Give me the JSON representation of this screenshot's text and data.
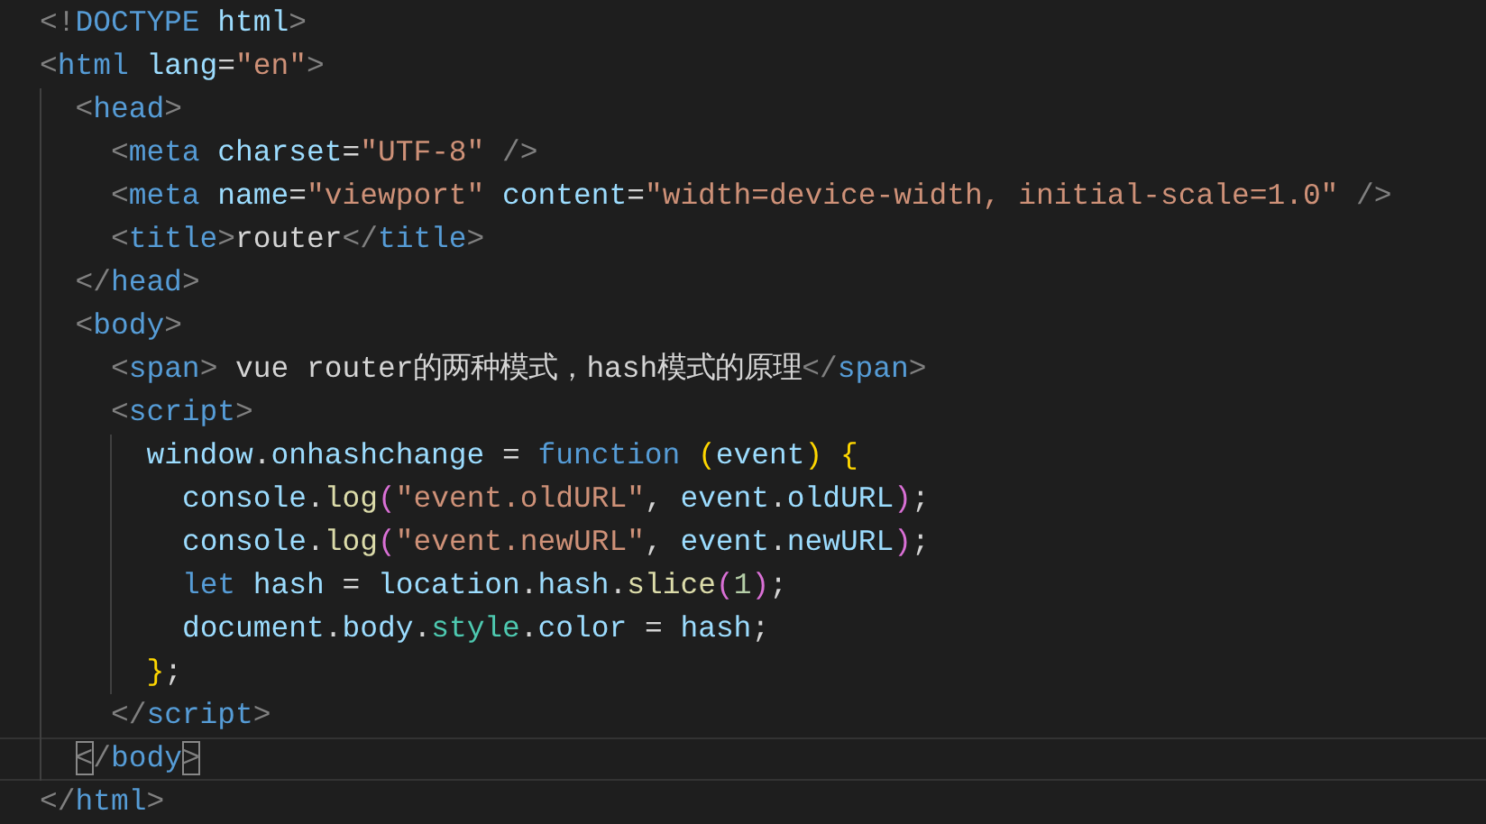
{
  "editor": {
    "lines": [
      {
        "current": false,
        "bracket_match": false,
        "tokens": [
          {
            "kind": "punct",
            "text": "<!"
          },
          {
            "kind": "tag",
            "text": "DOCTYPE"
          },
          {
            "kind": "attr",
            "text": " html"
          },
          {
            "kind": "punct",
            "text": ">"
          }
        ]
      },
      {
        "current": false,
        "bracket_match": false,
        "tokens": [
          {
            "kind": "punct",
            "text": "<"
          },
          {
            "kind": "tag",
            "text": "html"
          },
          {
            "kind": "attr",
            "text": " lang"
          },
          {
            "kind": "plain",
            "text": "="
          },
          {
            "kind": "string",
            "text": "\"en\""
          },
          {
            "kind": "punct",
            "text": ">"
          }
        ],
        "children": [
          {
            "current": false,
            "bracket_match": false,
            "tokens": [
              {
                "kind": "punct",
                "text": "<"
              },
              {
                "kind": "tag",
                "text": "head"
              },
              {
                "kind": "punct",
                "text": ">"
              }
            ],
            "children": [
              {
                "current": false,
                "bracket_match": false,
                "tokens": [
                  {
                    "kind": "punct",
                    "text": "<"
                  },
                  {
                    "kind": "tag",
                    "text": "meta"
                  },
                  {
                    "kind": "attr",
                    "text": " charset"
                  },
                  {
                    "kind": "plain",
                    "text": "="
                  },
                  {
                    "kind": "string",
                    "text": "\"UTF-8\""
                  },
                  {
                    "kind": "punct",
                    "text": " />"
                  }
                ]
              },
              {
                "current": false,
                "bracket_match": false,
                "tokens": [
                  {
                    "kind": "punct",
                    "text": "<"
                  },
                  {
                    "kind": "tag",
                    "text": "meta"
                  },
                  {
                    "kind": "attr",
                    "text": " name"
                  },
                  {
                    "kind": "plain",
                    "text": "="
                  },
                  {
                    "kind": "string",
                    "text": "\"viewport\""
                  },
                  {
                    "kind": "attr",
                    "text": " content"
                  },
                  {
                    "kind": "plain",
                    "text": "="
                  },
                  {
                    "kind": "string",
                    "text": "\"width=device-width, initial-scale=1.0\""
                  },
                  {
                    "kind": "punct",
                    "text": " />"
                  }
                ]
              },
              {
                "current": false,
                "bracket_match": false,
                "tokens": [
                  {
                    "kind": "punct",
                    "text": "<"
                  },
                  {
                    "kind": "tag",
                    "text": "title"
                  },
                  {
                    "kind": "punct",
                    "text": ">"
                  },
                  {
                    "kind": "plain",
                    "text": "router"
                  },
                  {
                    "kind": "punct",
                    "text": "</"
                  },
                  {
                    "kind": "tag",
                    "text": "title"
                  },
                  {
                    "kind": "punct",
                    "text": ">"
                  }
                ]
              }
            ]
          },
          {
            "current": false,
            "bracket_match": false,
            "tokens": [
              {
                "kind": "punct",
                "text": "</"
              },
              {
                "kind": "tag",
                "text": "head"
              },
              {
                "kind": "punct",
                "text": ">"
              }
            ]
          },
          {
            "current": false,
            "bracket_match": false,
            "tokens": [
              {
                "kind": "punct",
                "text": "<"
              },
              {
                "kind": "tag",
                "text": "body"
              },
              {
                "kind": "punct",
                "text": ">"
              }
            ],
            "children": [
              {
                "current": false,
                "bracket_match": false,
                "tokens": [
                  {
                    "kind": "punct",
                    "text": "<"
                  },
                  {
                    "kind": "tag",
                    "text": "span"
                  },
                  {
                    "kind": "punct",
                    "text": ">"
                  },
                  {
                    "kind": "plain",
                    "text": " vue router的两种模式，hash模式的原理"
                  },
                  {
                    "kind": "punct",
                    "text": "</"
                  },
                  {
                    "kind": "tag",
                    "text": "span"
                  },
                  {
                    "kind": "punct",
                    "text": ">"
                  }
                ]
              },
              {
                "current": false,
                "bracket_match": false,
                "tokens": [
                  {
                    "kind": "punct",
                    "text": "<"
                  },
                  {
                    "kind": "tag",
                    "text": "script"
                  },
                  {
                    "kind": "punct",
                    "text": ">"
                  }
                ],
                "children": [
                  {
                    "current": false,
                    "bracket_match": false,
                    "tokens": [
                      {
                        "kind": "var",
                        "text": "window"
                      },
                      {
                        "kind": "plain",
                        "text": "."
                      },
                      {
                        "kind": "var",
                        "text": "onhashchange"
                      },
                      {
                        "kind": "plain",
                        "text": " = "
                      },
                      {
                        "kind": "keyword",
                        "text": "function"
                      },
                      {
                        "kind": "bracket1",
                        "text": " ("
                      },
                      {
                        "kind": "var",
                        "text": "event"
                      },
                      {
                        "kind": "bracket1",
                        "text": ")"
                      },
                      {
                        "kind": "bracket1",
                        "text": " {"
                      }
                    ],
                    "children": [
                      {
                        "current": false,
                        "bracket_match": false,
                        "tokens": [
                          {
                            "kind": "var",
                            "text": "console"
                          },
                          {
                            "kind": "plain",
                            "text": "."
                          },
                          {
                            "kind": "func",
                            "text": "log"
                          },
                          {
                            "kind": "bracket2",
                            "text": "("
                          },
                          {
                            "kind": "string",
                            "text": "\"event.oldURL\""
                          },
                          {
                            "kind": "plain",
                            "text": ","
                          },
                          {
                            "kind": "var",
                            "text": " event"
                          },
                          {
                            "kind": "plain",
                            "text": "."
                          },
                          {
                            "kind": "var",
                            "text": "oldURL"
                          },
                          {
                            "kind": "bracket2",
                            "text": ")"
                          },
                          {
                            "kind": "plain",
                            "text": ";"
                          }
                        ]
                      },
                      {
                        "current": false,
                        "bracket_match": false,
                        "tokens": [
                          {
                            "kind": "var",
                            "text": "console"
                          },
                          {
                            "kind": "plain",
                            "text": "."
                          },
                          {
                            "kind": "func",
                            "text": "log"
                          },
                          {
                            "kind": "bracket2",
                            "text": "("
                          },
                          {
                            "kind": "string",
                            "text": "\"event.newURL\""
                          },
                          {
                            "kind": "plain",
                            "text": ","
                          },
                          {
                            "kind": "var",
                            "text": " event"
                          },
                          {
                            "kind": "plain",
                            "text": "."
                          },
                          {
                            "kind": "var",
                            "text": "newURL"
                          },
                          {
                            "kind": "bracket2",
                            "text": ")"
                          },
                          {
                            "kind": "plain",
                            "text": ";"
                          }
                        ]
                      },
                      {
                        "current": false,
                        "bracket_match": false,
                        "tokens": [
                          {
                            "kind": "keyword",
                            "text": "let"
                          },
                          {
                            "kind": "var",
                            "text": " hash"
                          },
                          {
                            "kind": "plain",
                            "text": " = "
                          },
                          {
                            "kind": "var",
                            "text": "location"
                          },
                          {
                            "kind": "plain",
                            "text": "."
                          },
                          {
                            "kind": "var",
                            "text": "hash"
                          },
                          {
                            "kind": "plain",
                            "text": "."
                          },
                          {
                            "kind": "func",
                            "text": "slice"
                          },
                          {
                            "kind": "bracket2",
                            "text": "("
                          },
                          {
                            "kind": "number",
                            "text": "1"
                          },
                          {
                            "kind": "bracket2",
                            "text": ")"
                          },
                          {
                            "kind": "plain",
                            "text": ";"
                          }
                        ]
                      },
                      {
                        "current": false,
                        "bracket_match": false,
                        "tokens": [
                          {
                            "kind": "var",
                            "text": "document"
                          },
                          {
                            "kind": "plain",
                            "text": "."
                          },
                          {
                            "kind": "var",
                            "text": "body"
                          },
                          {
                            "kind": "plain",
                            "text": "."
                          },
                          {
                            "kind": "prop",
                            "text": "style"
                          },
                          {
                            "kind": "plain",
                            "text": "."
                          },
                          {
                            "kind": "var",
                            "text": "color"
                          },
                          {
                            "kind": "plain",
                            "text": " = "
                          },
                          {
                            "kind": "var",
                            "text": "hash"
                          },
                          {
                            "kind": "plain",
                            "text": ";"
                          }
                        ]
                      }
                    ]
                  },
                  {
                    "current": false,
                    "bracket_match": false,
                    "tokens": [
                      {
                        "kind": "bracket1",
                        "text": "}"
                      },
                      {
                        "kind": "plain",
                        "text": ";"
                      }
                    ]
                  }
                ]
              },
              {
                "current": false,
                "bracket_match": false,
                "tokens": [
                  {
                    "kind": "punct",
                    "text": "</"
                  },
                  {
                    "kind": "tag",
                    "text": "script"
                  },
                  {
                    "kind": "punct",
                    "text": ">"
                  }
                ]
              }
            ]
          },
          {
            "current": true,
            "bracket_match": true,
            "tokens": [
              {
                "kind": "punct",
                "text": "<"
              },
              {
                "kind": "punct",
                "text": "/"
              },
              {
                "kind": "tag",
                "text": "body"
              },
              {
                "kind": "punct",
                "text": ">"
              }
            ]
          }
        ]
      },
      {
        "current": false,
        "bracket_match": false,
        "tokens": [
          {
            "kind": "punct",
            "text": "</"
          },
          {
            "kind": "tag",
            "text": "html"
          },
          {
            "kind": "punct",
            "text": ">"
          }
        ]
      }
    ]
  }
}
